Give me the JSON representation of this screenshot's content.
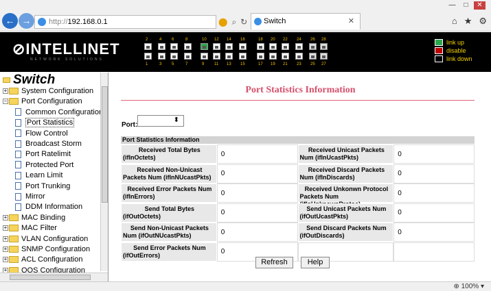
{
  "browser": {
    "url_prefix": "http://",
    "url_host": "192.168.0.1",
    "tab_title": "Switch"
  },
  "banner": {
    "logo": "⊘INTELLINET",
    "tagline": "NETWORK SOLUTIONS",
    "port_top_numbers": [
      "2",
      "4",
      "6",
      "8",
      "10",
      "12",
      "14",
      "16",
      "18",
      "20",
      "22",
      "24",
      "26",
      "28"
    ],
    "port_bottom_numbers": [
      "1",
      "3",
      "5",
      "7",
      "9",
      "11",
      "13",
      "15",
      "17",
      "19",
      "21",
      "23",
      "25",
      "27"
    ],
    "legend": {
      "link_up": "link up",
      "disable": "disable",
      "link_down": "link down"
    }
  },
  "sidebar": {
    "title": "Switch",
    "items": [
      {
        "label": "System Configuration",
        "type": "folder",
        "level": 0,
        "expanded": false
      },
      {
        "label": "Port Configuration",
        "type": "folder",
        "level": 0,
        "expanded": true
      },
      {
        "label": "Common Configuration",
        "type": "page",
        "level": 1
      },
      {
        "label": "Port Statistics",
        "type": "page",
        "level": 1,
        "selected": true
      },
      {
        "label": "Flow Control",
        "type": "page",
        "level": 1
      },
      {
        "label": "Broadcast Storm",
        "type": "page",
        "level": 1
      },
      {
        "label": "Port Ratelimit",
        "type": "page",
        "level": 1
      },
      {
        "label": "Protected Port",
        "type": "page",
        "level": 1
      },
      {
        "label": "Learn Limit",
        "type": "page",
        "level": 1
      },
      {
        "label": "Port Trunking",
        "type": "page",
        "level": 1
      },
      {
        "label": "Mirror",
        "type": "page",
        "level": 1
      },
      {
        "label": "DDM Information",
        "type": "page",
        "level": 1
      },
      {
        "label": "MAC Binding",
        "type": "folder",
        "level": 0,
        "expanded": false
      },
      {
        "label": "MAC Filter",
        "type": "folder",
        "level": 0,
        "expanded": false
      },
      {
        "label": "VLAN Configuration",
        "type": "folder",
        "level": 0,
        "expanded": false
      },
      {
        "label": "SNMP Configuration",
        "type": "folder",
        "level": 0,
        "expanded": false
      },
      {
        "label": "ACL Configuration",
        "type": "folder",
        "level": 0,
        "expanded": false
      },
      {
        "label": "QOS Configuration",
        "type": "folder",
        "level": 0,
        "expanded": false
      }
    ]
  },
  "main": {
    "title": "Port Statistics Information",
    "port_label": "Port:",
    "port_value": "",
    "section_header": "Port Statistics Information",
    "rows": [
      [
        {
          "l1": "Received Total Bytes",
          "l2": "(ifInOctets)",
          "v": "0"
        },
        {
          "l1": "Received Unicast Packets",
          "l2": "Num (ifInUcastPkts)",
          "v": "0"
        }
      ],
      [
        {
          "l1": "Received Non-Unicast",
          "l2": "Packets Num (ifInNUcastPkts)",
          "v": "0"
        },
        {
          "l1": "Received Discard Packets",
          "l2": "Num (ifInDiscards)",
          "v": "0"
        }
      ],
      [
        {
          "l1": "Received Error Packets Num",
          "l2": "(ifInErrors)",
          "v": "0"
        },
        {
          "l1": "Received Unkonwn Protocol",
          "l2": "Packets Num (ifInUnknownProtos)",
          "v": "0"
        }
      ],
      [
        {
          "l1": "Send Total Bytes",
          "l2": "(ifOutOctets)",
          "v": "0"
        },
        {
          "l1": "Send Unicast Packets Num",
          "l2": "(ifOutUcastPkts)",
          "v": "0"
        }
      ],
      [
        {
          "l1": "Send Non-Unicast Packets",
          "l2": "Num (ifOutNUcastPkts)",
          "v": "0"
        },
        {
          "l1": "Send Discard Packets Num",
          "l2": "(ifOutDiscards)",
          "v": "0"
        }
      ],
      [
        {
          "l1": "Send Error Packets Num",
          "l2": "(ifOutErrors)",
          "v": "0"
        },
        {
          "l1": "",
          "l2": "",
          "v": ""
        }
      ]
    ],
    "buttons": {
      "refresh": "Refresh",
      "help": "Help"
    }
  },
  "statusbar": {
    "zoom": "100%"
  }
}
